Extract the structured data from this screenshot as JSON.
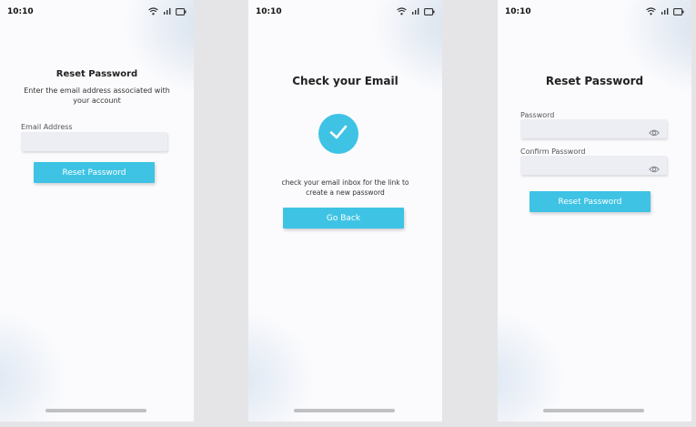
{
  "status_bar": {
    "time": "10:10"
  },
  "screens": [
    {
      "title": "Reset Password",
      "subtitle": "Enter the email address associated with your account",
      "email_label": "Email Address",
      "email_value": "",
      "button_label": "Reset Password"
    },
    {
      "title": "Check your Email",
      "icon": "check-icon",
      "message": "check your email inbox for the link to create a new password",
      "button_label": "Go Back"
    },
    {
      "title": "Reset Password",
      "password_label": "Password",
      "password_value": "",
      "confirm_label": "Confirm Password",
      "confirm_value": "",
      "button_label": "Reset Password"
    }
  ],
  "colors": {
    "accent": "#3ec3e4",
    "field_bg": "#eceef3",
    "background": "#fbfbfd"
  }
}
